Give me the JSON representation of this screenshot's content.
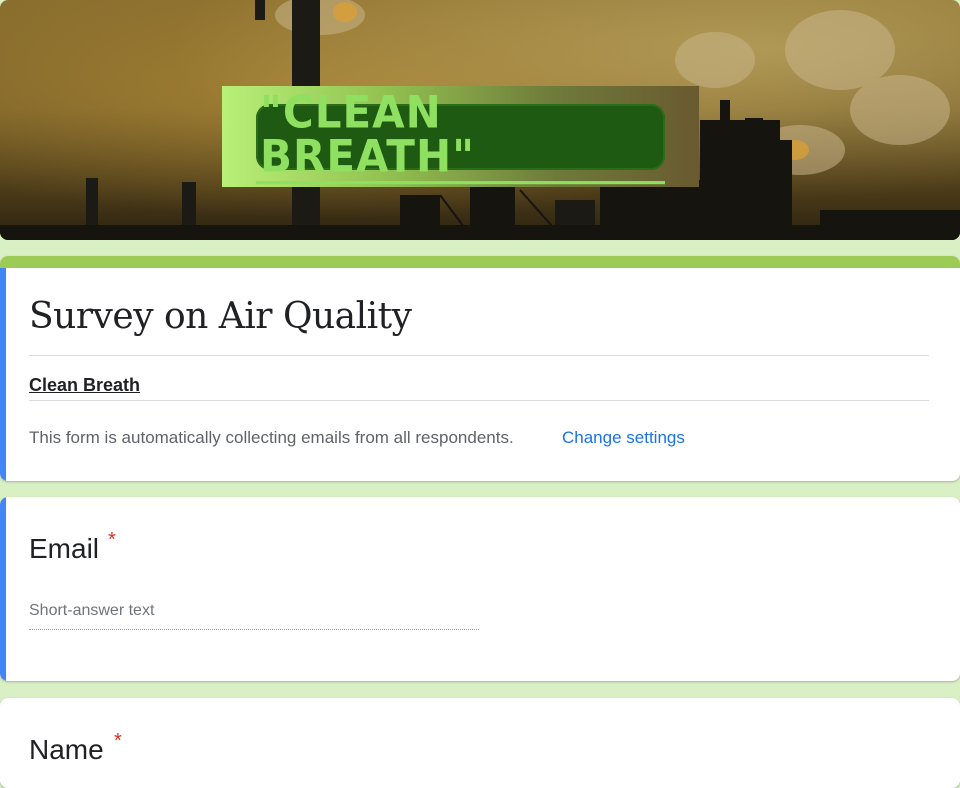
{
  "banner": {
    "logo_text": "\"CLEAN BREATH\""
  },
  "form": {
    "title": "Survey on Air Quality",
    "organization": "Clean Breath",
    "collecting_notice": "This form is automatically collecting emails from all respondents.",
    "change_settings_label": "Change settings"
  },
  "questions": [
    {
      "label": "Email",
      "required_mark": "*",
      "placeholder": "Short-answer text"
    },
    {
      "label": "Name",
      "required_mark": "*"
    }
  ],
  "colors": {
    "background": "#d9efc4",
    "theme_accent": "#9ccc56",
    "focus_accent": "#4285f4",
    "link": "#1a73e8",
    "required": "#d93025"
  },
  "icons": [
    "factory-header-image"
  ]
}
